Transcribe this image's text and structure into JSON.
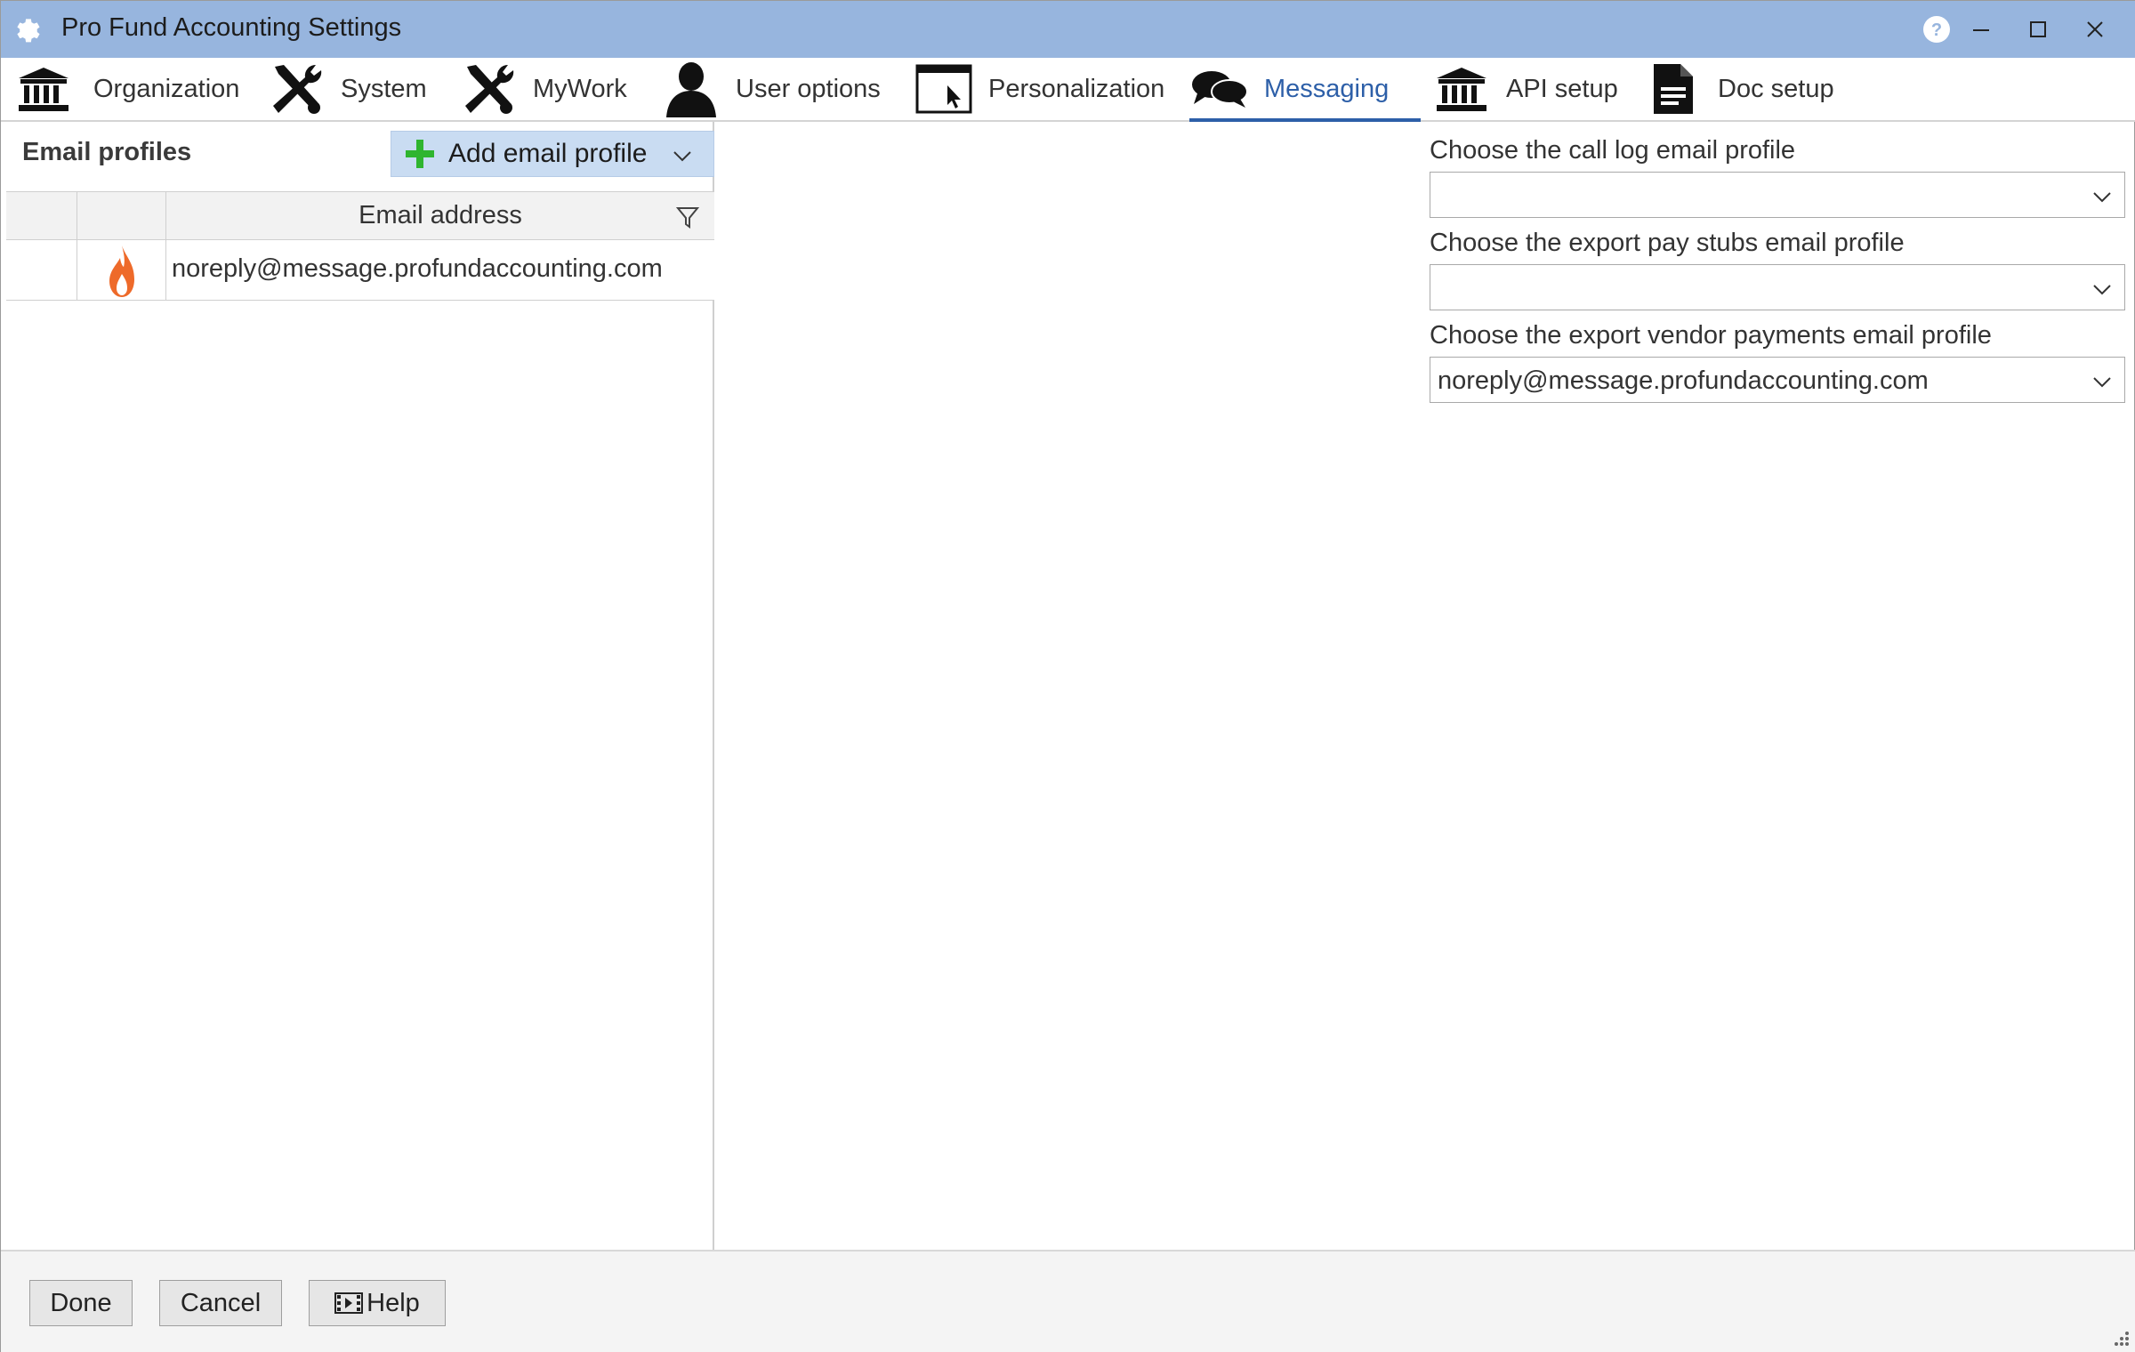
{
  "window": {
    "title": "Pro Fund Accounting Settings"
  },
  "tabs": [
    {
      "label": "Organization",
      "icon": "bank-icon"
    },
    {
      "label": "System",
      "icon": "tools-icon"
    },
    {
      "label": "MyWork",
      "icon": "tools-icon"
    },
    {
      "label": "User options",
      "icon": "user-icon"
    },
    {
      "label": "Personalization",
      "icon": "window-cursor-icon"
    },
    {
      "label": "Messaging",
      "icon": "chat-bubbles-icon",
      "active": true
    },
    {
      "label": "API setup",
      "icon": "bank-icon"
    },
    {
      "label": "Doc setup",
      "icon": "document-icon"
    }
  ],
  "email_profiles": {
    "title": "Email profiles",
    "add_button_label": "Add email profile",
    "columns": [
      "",
      "",
      "Email address"
    ],
    "rows": [
      {
        "icon": "flame-icon",
        "email": "noreply@message.profundaccounting.com"
      }
    ]
  },
  "settings": {
    "call_log_label": "Choose the call log email profile",
    "call_log_value": "",
    "pay_stubs_label": "Choose the export pay stubs email profile",
    "pay_stubs_value": "",
    "vendor_payments_label": "Choose the export vendor payments email profile",
    "vendor_payments_value": "noreply@message.profundaccounting.com"
  },
  "footer": {
    "done_label": "Done",
    "cancel_label": "Cancel",
    "help_label": "Help"
  },
  "colors": {
    "titlebar": "#97b5de",
    "active_tab": "#2d5fa8",
    "add_button": "#c9dcf2",
    "plus": "#2fb52f",
    "flame": "#ee6a2a"
  }
}
